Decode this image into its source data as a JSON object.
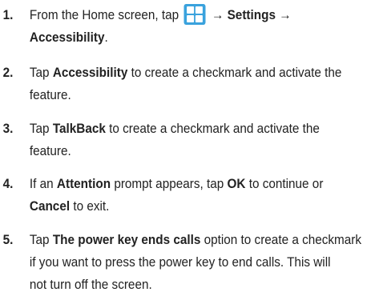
{
  "steps": [
    {
      "number": "1.",
      "line1_before": "From the Home screen, tap",
      "icon": "apps-grid-icon",
      "line1_after": "→ Settings →",
      "line2": "Accessibility",
      "line2_tail": "."
    },
    {
      "number": "2.",
      "a": "Tap ",
      "b": "Accessibility",
      "c": " to create a checkmark and activate the",
      "line2": "feature."
    },
    {
      "number": "3.",
      "a": "Tap ",
      "b": "TalkBack",
      "c": " to create a checkmark and activate the",
      "line2": "feature."
    },
    {
      "number": "4.",
      "a": "If an ",
      "b": "Attention",
      "c": " prompt appears, tap ",
      "d": "OK",
      "e": " to continue or",
      "line2_bold": "Cancel",
      "line2_tail": " to exit."
    },
    {
      "number": "5.",
      "a": "Tap ",
      "b": "The power key ends calls",
      "c": " option to create a checkmark",
      "line2": "if you want to press the power key to end calls. This will",
      "line3": "not turn off the screen."
    }
  ],
  "colors": {
    "icon_blue": "#3aa2dd",
    "text": "#222222"
  }
}
